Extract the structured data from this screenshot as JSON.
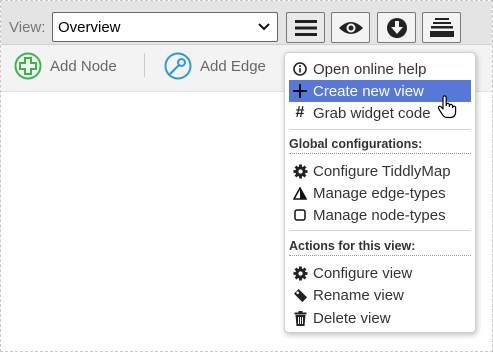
{
  "toolbar": {
    "view_label": "View:",
    "view_value": "Overview",
    "buttons": [
      "menu-icon",
      "eye-icon",
      "download-icon",
      "stack-icon"
    ]
  },
  "actions": {
    "add_node": "Add Node",
    "add_edge": "Add Edge"
  },
  "menu": {
    "items": [
      {
        "label": "Open online help",
        "icon": "info-icon"
      },
      {
        "label": "Create new view",
        "icon": "plus-icon",
        "active": true
      },
      {
        "label": "Grab widget code",
        "icon": "hash-icon"
      }
    ],
    "global_header": "Global configurations:",
    "global_items": [
      {
        "label": "Configure TiddlyMap",
        "icon": "gear-icon"
      },
      {
        "label": "Manage edge-types",
        "icon": "triangle-icon"
      },
      {
        "label": "Manage node-types",
        "icon": "square-icon"
      }
    ],
    "view_header": "Actions for this view:",
    "view_items": [
      {
        "label": "Configure view",
        "icon": "gear-icon"
      },
      {
        "label": "Rename view",
        "icon": "tag-icon"
      },
      {
        "label": "Delete view",
        "icon": "trash-icon"
      }
    ]
  },
  "colors": {
    "active_item": "#5778d8",
    "add_node_icon": "#3cb44b",
    "add_edge_icon": "#2b9bd8"
  }
}
